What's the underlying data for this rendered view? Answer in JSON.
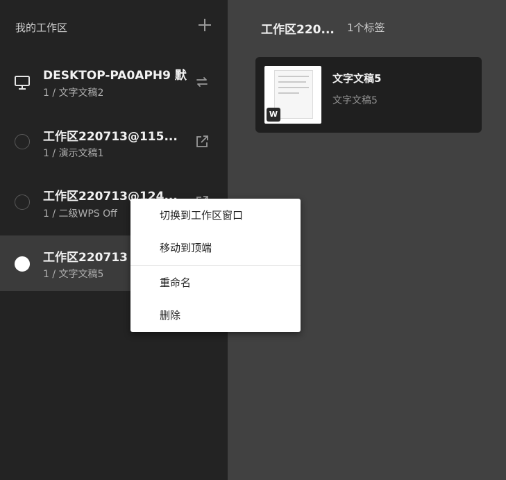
{
  "sidebar": {
    "header": "我的工作区",
    "add_icon": "plus-icon",
    "items": [
      {
        "title": "DESKTOP-PA0APH9 默",
        "sub": "1 / 文字文稿2",
        "icon": "monitor-icon",
        "action_icon": "switch-icon"
      },
      {
        "title": "工作区220713@115...",
        "sub": "1 / 演示文稿1",
        "icon": "radio-empty",
        "action_icon": "external-link-icon"
      },
      {
        "title": "工作区220713@124...",
        "sub": "1 / 二级WPS Off",
        "icon": "radio-empty",
        "action_icon": "external-link-icon"
      },
      {
        "title": "工作区220713",
        "sub": "1 / 文字文稿5",
        "icon": "radio-filled",
        "active": true
      }
    ]
  },
  "main": {
    "title": "工作区220...",
    "count": "1个标签",
    "tab": {
      "title": "文字文稿5",
      "sub": "文字文稿5",
      "badge": "W"
    }
  },
  "context_menu": {
    "items": [
      "切换到工作区窗口",
      "移动到顶端",
      "重命名",
      "删除"
    ]
  },
  "colors": {
    "sidebar_bg": "#232323",
    "main_bg": "#414141",
    "active_item_bg": "#3b3b3b",
    "card_bg": "#1f1f1f",
    "menu_bg": "#ffffff"
  }
}
